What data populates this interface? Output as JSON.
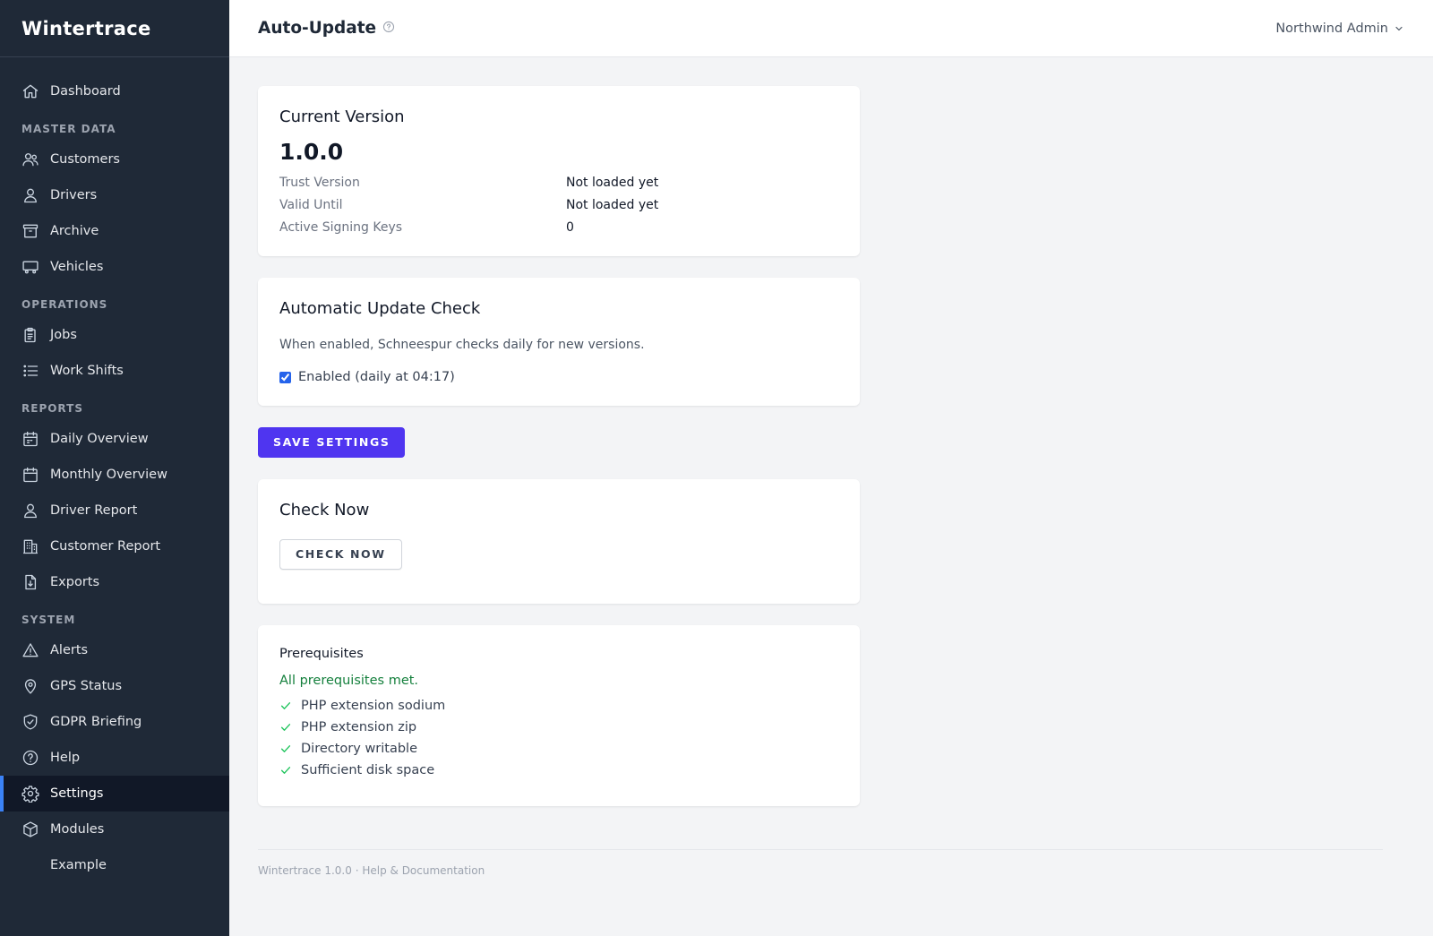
{
  "app": {
    "brand": "Wintertrace"
  },
  "sidebar": {
    "dashboard": {
      "label": "Dashboard",
      "icon": "home-icon"
    },
    "sections": [
      {
        "title": "MASTER DATA",
        "items": [
          {
            "label": "Customers",
            "icon": "users-icon"
          },
          {
            "label": "Drivers",
            "icon": "user-icon"
          },
          {
            "label": "Archive",
            "icon": "archive-icon"
          },
          {
            "label": "Vehicles",
            "icon": "truck-icon"
          }
        ]
      },
      {
        "title": "OPERATIONS",
        "items": [
          {
            "label": "Jobs",
            "icon": "clipboard-icon"
          },
          {
            "label": "Work Shifts",
            "icon": "list-icon"
          }
        ]
      },
      {
        "title": "REPORTS",
        "items": [
          {
            "label": "Daily Overview",
            "icon": "calendar-icon"
          },
          {
            "label": "Monthly Overview",
            "icon": "calendar-icon"
          },
          {
            "label": "Driver Report",
            "icon": "user-icon"
          },
          {
            "label": "Customer Report",
            "icon": "building-icon"
          },
          {
            "label": "Exports",
            "icon": "file-download-icon"
          }
        ]
      },
      {
        "title": "SYSTEM",
        "items": [
          {
            "label": "Alerts",
            "icon": "warning-icon"
          },
          {
            "label": "GPS Status",
            "icon": "map-pin-icon"
          },
          {
            "label": "GDPR Briefing",
            "icon": "shield-check-icon"
          },
          {
            "label": "Help",
            "icon": "question-circle-icon"
          },
          {
            "label": "Settings",
            "icon": "gear-icon",
            "active": true
          },
          {
            "label": "Modules",
            "icon": "cube-icon"
          },
          {
            "label": "Example",
            "icon": ""
          }
        ]
      }
    ]
  },
  "header": {
    "title": "Auto-Update",
    "user": "Northwind Admin"
  },
  "current_version": {
    "title": "Current Version",
    "version": "1.0.0",
    "rows": [
      {
        "label": "Trust Version",
        "value": "Not loaded yet"
      },
      {
        "label": "Valid Until",
        "value": "Not loaded yet"
      },
      {
        "label": "Active Signing Keys",
        "value": "0"
      }
    ]
  },
  "auto_check": {
    "title": "Automatic Update Check",
    "description": "When enabled, Schneespur checks daily for new versions.",
    "checkbox_label": "Enabled (daily at 04:17)",
    "checked": true
  },
  "save_button": "SAVE SETTINGS",
  "check_now": {
    "title": "Check Now",
    "button": "CHECK NOW"
  },
  "prerequisites": {
    "title": "Prerequisites",
    "status": "All prerequisites met.",
    "items": [
      "PHP extension sodium",
      "PHP extension zip",
      "Directory writable",
      "Sufficient disk space"
    ]
  },
  "footer": {
    "version": "Wintertrace 1.0.0",
    "separator": " · ",
    "link": "Help & Documentation"
  },
  "colors": {
    "sidebar_bg": "#1f2937",
    "active_bar": "#3b82f6",
    "primary_button": "#4f35f0",
    "success": "#15803d"
  }
}
